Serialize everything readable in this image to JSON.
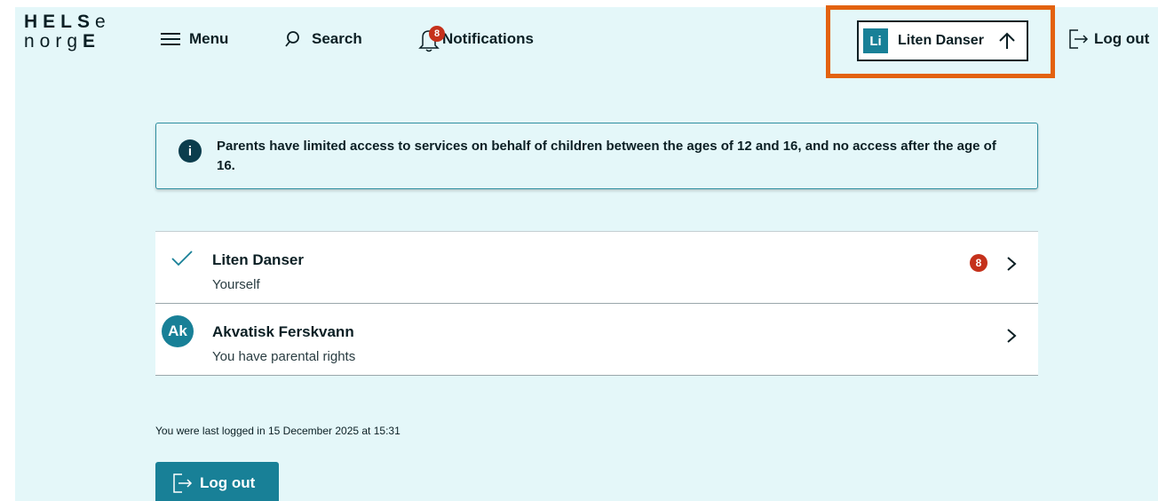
{
  "logo": {
    "line1": "HELSe",
    "line2": "norgE"
  },
  "header": {
    "menu_label": "Menu",
    "search_label": "Search",
    "notifications_label": "Notifications",
    "notifications_count": "8",
    "user_initials": "Li",
    "user_name": "Liten Danser",
    "logout_label": "Log out"
  },
  "alert": {
    "icon": "i",
    "text": "Parents have limited access to services on behalf of children between the ages of 12 and 16, and no access after the age of 16."
  },
  "profiles": [
    {
      "name": "Liten Danser",
      "subtitle": "Yourself",
      "badge": "8",
      "selected": true
    },
    {
      "name": "Akvatisk Ferskvann",
      "subtitle": "You have parental rights",
      "initials": "Ak"
    }
  ],
  "footer": {
    "last_login": "You were last logged in 15 December 2025 at 15:31",
    "logout_label": "Log out"
  },
  "colors": {
    "background": "#e4f7f9",
    "accent": "#188097",
    "badge": "#c5311b",
    "highlight": "#e3620f"
  }
}
